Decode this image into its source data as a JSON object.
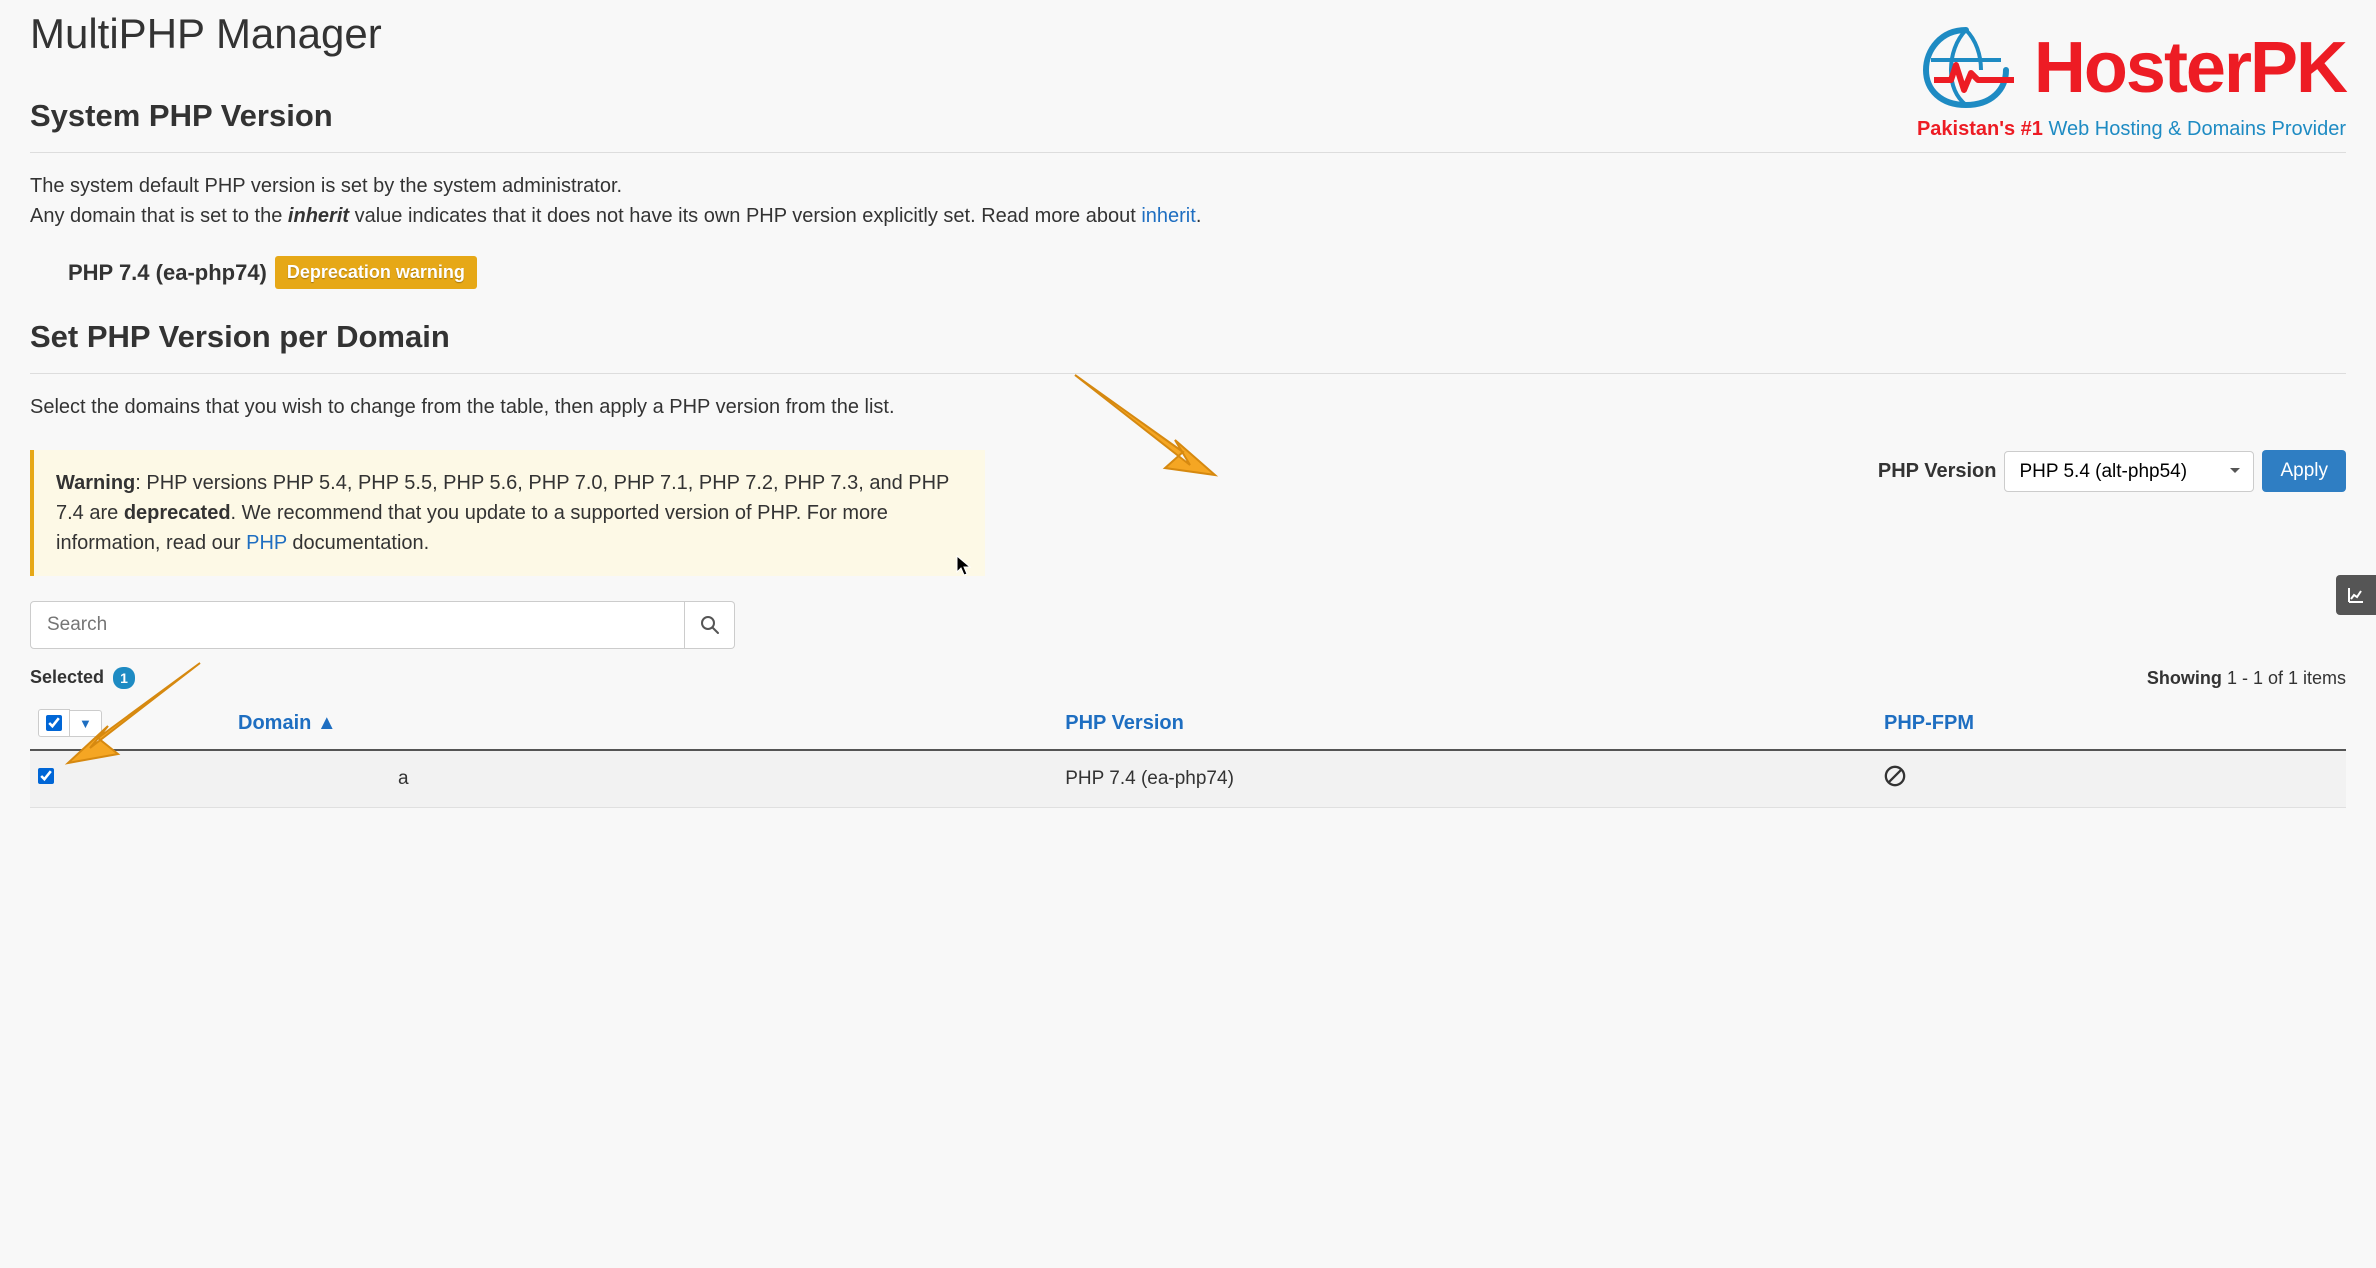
{
  "page": {
    "title": "MultiPHP Manager"
  },
  "logo": {
    "brand": "HosterPK",
    "tag_red": "Pakistan's #1",
    "tag_blue": "Web Hosting & Domains Provider"
  },
  "system_version": {
    "heading": "System PHP Version",
    "desc1": "The system default PHP version is set by the system administrator.",
    "desc2_pre": "Any domain that is set to the ",
    "desc2_em": "inherit",
    "desc2_mid": " value indicates that it does not have its own PHP version explicitly set. Read more about ",
    "desc2_link": "inherit",
    "desc2_end": ".",
    "version": "PHP 7.4 (ea-php74)",
    "badge": "Deprecation warning"
  },
  "per_domain": {
    "heading": "Set PHP Version per Domain",
    "desc": "Select the domains that you wish to change from the table, then apply a PHP version from the list."
  },
  "alert": {
    "strong1": "Warning",
    "text1": ": PHP versions PHP 5.4, PHP 5.5, PHP 5.6, PHP 7.0, PHP 7.1, PHP 7.2, PHP 7.3, and PHP 7.4 are ",
    "strong2": "deprecated",
    "text2": ". We recommend that you update to a supported version of PHP. For more information, read our ",
    "link": "PHP",
    "text3": " documentation."
  },
  "version_control": {
    "label": "PHP Version",
    "selected": "PHP 5.4 (alt-php54)",
    "apply": "Apply"
  },
  "search": {
    "placeholder": "Search"
  },
  "meta": {
    "selected_label": "Selected",
    "selected_count": "1",
    "showing_label": "Showing",
    "showing_range": "1 - 1 of 1 items"
  },
  "table": {
    "headers": {
      "domain": "Domain",
      "sort_arrow": "▲",
      "php_version": "PHP Version",
      "php_fpm": "PHP-FPM"
    },
    "rows": [
      {
        "domain_suffix": "a",
        "php_version": "PHP 7.4 (ea-php74)"
      }
    ]
  }
}
